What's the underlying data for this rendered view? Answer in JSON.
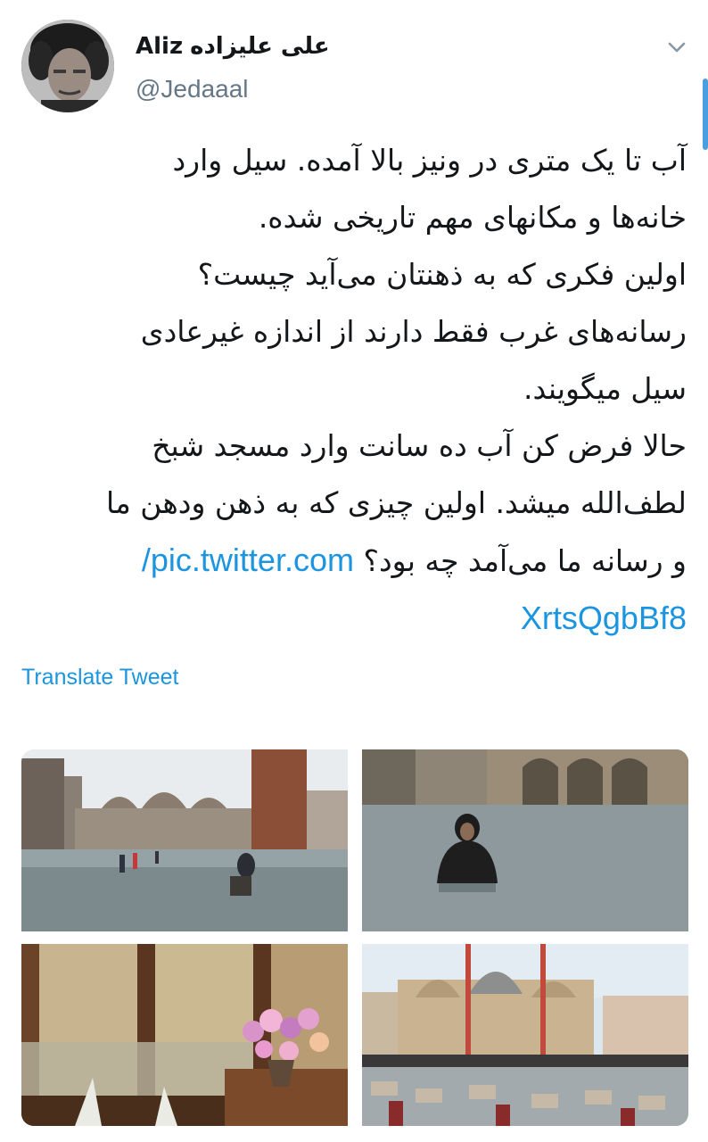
{
  "user": {
    "display_name_latin": "Aliz",
    "display_name_persian": "علی علیزاده",
    "handle": "@Jedaaal"
  },
  "tweet": {
    "lines": [
      "آب تا یک متری در ونیز بالا آمده. سیل وارد",
      "خانه‌ها و مکانهای مهم تاریخی شده.",
      "اولین فکری که به ذهنتان می‌آید چیست؟",
      "رسانه‌های غرب فقط دارند از اندازه غیرعادی",
      "سیل میگویند.",
      "حالا فرض کن آب ده سانت وارد مسجد شبخ",
      "لطف‌الله میشد. اولین چیزی که به ذهن ودهن ما",
      "و رسانه ما می‌آمد چه بود؟"
    ],
    "link_part1": "pic.twitter.com/",
    "link_part2": "XrtsQgbBf8"
  },
  "translate_label": "Translate Tweet",
  "icons": {
    "menu": "chevron-down-icon"
  },
  "colors": {
    "link": "#1b95e0",
    "handle": "#657786",
    "text": "#14171a"
  }
}
